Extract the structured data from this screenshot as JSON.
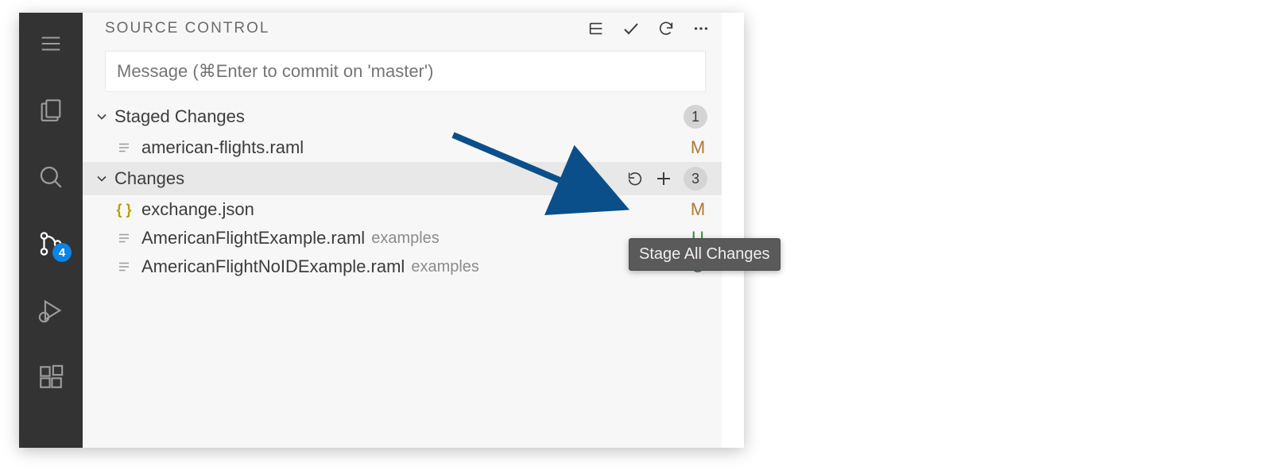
{
  "scm": {
    "title": "SOURCE CONTROL",
    "commit_placeholder": "Message (⌘Enter to commit on 'master')",
    "scm_badge": "4",
    "staged": {
      "label": "Staged Changes",
      "count": "1",
      "items": [
        {
          "name": "american-flights.raml",
          "status": "M"
        }
      ]
    },
    "changes": {
      "label": "Changes",
      "count": "3",
      "items": [
        {
          "name": "exchange.json",
          "dir": "",
          "status": "M",
          "icon": "json"
        },
        {
          "name": "AmericanFlightExample.raml",
          "dir": "examples",
          "status": "U",
          "icon": "lines"
        },
        {
          "name": "AmericanFlightNoIDExample.raml",
          "dir": "examples",
          "status": "U",
          "icon": "lines"
        }
      ]
    },
    "tooltip": "Stage All Changes"
  }
}
